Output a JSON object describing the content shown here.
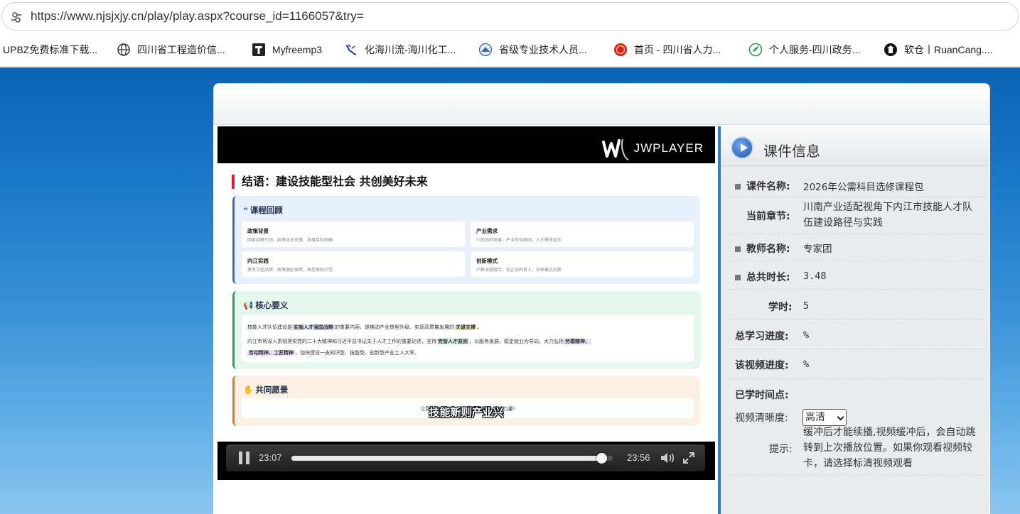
{
  "browser": {
    "url": "https://www.njsjxjy.cn/play/play.aspx?course_id=1166057&try="
  },
  "bookmarks": [
    {
      "label": "UPBZ免费标准下载...",
      "icon": "none"
    },
    {
      "label": "四川省工程造价信...",
      "icon": "globe-icon"
    },
    {
      "label": "Myfreemp3",
      "icon": "t-logo-icon"
    },
    {
      "label": "化海川流-海川化工...",
      "icon": "haichuan-icon"
    },
    {
      "label": "省级专业技术人员...",
      "icon": "province-icon"
    },
    {
      "label": "首页 - 四川省人力...",
      "icon": "red-badge-icon"
    },
    {
      "label": "个人服务-四川政务...",
      "icon": "sichuan-gov-icon"
    },
    {
      "label": "软仓丨RuanCang....",
      "icon": "ruancang-icon"
    }
  ],
  "player": {
    "brand": "JWPLAYER",
    "current_time": "23:07",
    "duration": "23:56",
    "progress": 0.965,
    "subtitle": "技能新则产业兴"
  },
  "slide": {
    "title": "结语：建设技能型社会 共创美好未来",
    "review": {
      "heading": "课程回顾",
      "items": [
        {
          "title": "政策背景",
          "desc": "国家战略引领，政策体系支撑，发展目标明确"
        },
        {
          "title": "产业需求",
          "desc": "川南协同发展，产业特色鲜明，人才需求迫切"
        },
        {
          "title": "内江实践",
          "desc": "擦亮工匠品牌，政策激励保障，典型案例示范"
        },
        {
          "title": "创新模式",
          "desc": "产教深度融合，校企协同育人，培养模式创新"
        }
      ]
    },
    "core": {
      "heading": "核心要义",
      "line1_pre": "技能人才队伍建设是",
      "line1_hl1": "实施人才强国战略",
      "line1_mid": "的重要内容，是推动产业转型升级、实现高质量发展的",
      "line1_hl2": "关键支撑",
      "line1_post": "。",
      "line2_pre": "内江市将深入贯彻落实党的二十大精神和习近平总书记关于人才工作的重要论述，坚持",
      "line2_hl1": "党管人才原则",
      "line2_mid": "，以服务发展、稳定就业为导向，大力弘扬",
      "line2_hl2": "劳模精神、",
      "line3_hl": "劳动精神、工匠精神",
      "line3_post": "，加快建设一支知识型、技能型、创新型产业工人大军。"
    },
    "vision": {
      "heading": "共同愿景",
      "text_pre": "让我们携手并进，共",
      "text_hl": "高质量发展",
      "text_post": "贡献力量!"
    }
  },
  "info": {
    "title": "课件信息",
    "course_name_label": "课件名称:",
    "course_name": "2026年公需科目选修课程包",
    "chapter_label": "当前章节:",
    "chapter": "川南产业适配视角下内江市技能人才队伍建设路径与实践",
    "teacher_label": "教师名称:",
    "teacher": "专家团",
    "duration_label": "总共时长:",
    "duration": "3.48",
    "credits_label": "学时:",
    "credits": "5",
    "total_progress_label": "总学习进度:",
    "total_progress": "%",
    "video_progress_label": "该视频进度:",
    "video_progress": "%",
    "time_points_label": "已学时间点:",
    "quality_label": "视频清晰度:",
    "quality_value": "高清",
    "tip_label": "提示:",
    "tip": "缓冲后才能续播,视频缓冲后，会自动跳转到上次播放位置。如果你观看视频较卡，请选择标清视频观看"
  }
}
